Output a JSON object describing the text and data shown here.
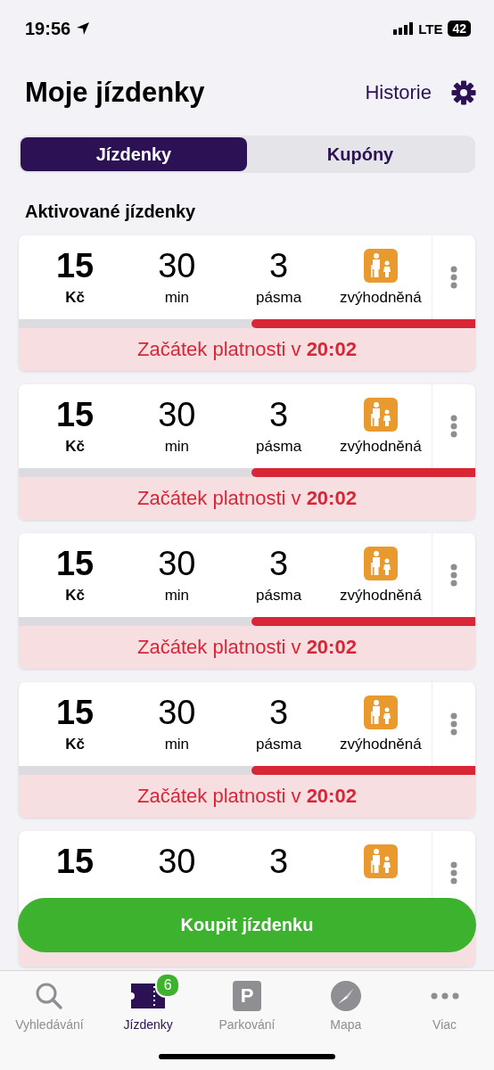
{
  "status_bar": {
    "time": "19:56",
    "network": "LTE",
    "battery": "42"
  },
  "header": {
    "title": "Moje jízdenky",
    "history_link": "Historie"
  },
  "tabs": [
    {
      "label": "Jízdenky",
      "selected": true
    },
    {
      "label": "Kupóny",
      "selected": false
    }
  ],
  "section_title": "Aktivované jízdenky",
  "tickets": [
    {
      "cells": [
        {
          "kind": "price",
          "value": "15",
          "unit": "Kč"
        },
        {
          "kind": "number",
          "value": "30",
          "unit": "min"
        },
        {
          "kind": "number",
          "value": "3",
          "unit": "pásma"
        },
        {
          "kind": "tariff",
          "unit": "zvýhodněná"
        }
      ],
      "level": 0.49,
      "status": "Začátek platnosti v **20:02**"
    },
    {
      "cells": [
        {
          "kind": "price",
          "value": "15",
          "unit": "Kč"
        },
        {
          "kind": "number",
          "value": "30",
          "unit": "min"
        },
        {
          "kind": "number",
          "value": "3",
          "unit": "pásma"
        },
        {
          "kind": "tariff",
          "unit": "zvýhodněná"
        }
      ],
      "level": 0.49,
      "status": "Začátek platnosti v **20:02**"
    },
    {
      "cells": [
        {
          "kind": "price",
          "value": "15",
          "unit": "Kč"
        },
        {
          "kind": "number",
          "value": "30",
          "unit": "min"
        },
        {
          "kind": "number",
          "value": "3",
          "unit": "pásma"
        },
        {
          "kind": "tariff",
          "unit": "zvýhodněná"
        }
      ],
      "level": 0.49,
      "status": "Začátek platnosti v **20:02**"
    },
    {
      "cells": [
        {
          "kind": "price",
          "value": "15",
          "unit": "Kč"
        },
        {
          "kind": "number",
          "value": "30",
          "unit": "min"
        },
        {
          "kind": "number",
          "value": "3",
          "unit": "pásma"
        },
        {
          "kind": "tariff",
          "unit": "zvýhodněná"
        }
      ],
      "level": 0.49,
      "status": "Začátek platnosti v **20:02**"
    },
    {
      "cells": [
        {
          "kind": "price",
          "value": "15"
        },
        {
          "kind": "number",
          "value": "30"
        },
        {
          "kind": "number",
          "value": "3"
        },
        {
          "kind": "tariff"
        }
      ]
    }
  ],
  "buy_button": "Koupit jízdenku",
  "nav": [
    {
      "kind": "search",
      "label": "Vyhledávání",
      "selected": false
    },
    {
      "kind": "ticket",
      "label": "Jízdenky",
      "selected": true,
      "badge": "6"
    },
    {
      "kind": "parking",
      "label": "Parkování",
      "selected": false,
      "icon_text": "P"
    },
    {
      "kind": "map",
      "label": "Mapa",
      "selected": false
    },
    {
      "kind": "more",
      "label": "Viac",
      "selected": false
    }
  ]
}
